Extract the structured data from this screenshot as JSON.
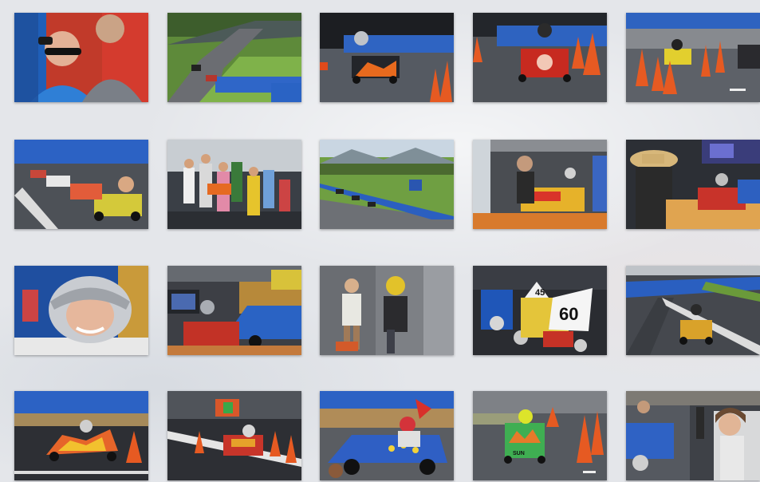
{
  "gallery": {
    "photos": [
      {
        "scene": "spectators"
      },
      {
        "scene": "overview-track"
      },
      {
        "scene": "kart-flame"
      },
      {
        "scene": "kart-red-sun"
      },
      {
        "scene": "kart-yellow-cones"
      },
      {
        "scene": "karts-lineup"
      },
      {
        "scene": "kids-crowd"
      },
      {
        "scene": "landscape-track"
      },
      {
        "scene": "kart-start-ramp"
      },
      {
        "scene": "hat-spectator"
      },
      {
        "scene": "helmet-smile"
      },
      {
        "scene": "kart-blue-tunnel"
      },
      {
        "scene": "kid-yellow-helmet"
      },
      {
        "scene": "number-plates",
        "plate_numbers": [
          "45",
          "60"
        ]
      },
      {
        "scene": "tunnel-curve"
      },
      {
        "scene": "kart-flame-wide"
      },
      {
        "scene": "tunnel-kart-motion"
      },
      {
        "scene": "kart-blue-stars"
      },
      {
        "scene": "kart-green-sun",
        "kart_text": "SUN"
      },
      {
        "scene": "kids-watching"
      }
    ]
  }
}
